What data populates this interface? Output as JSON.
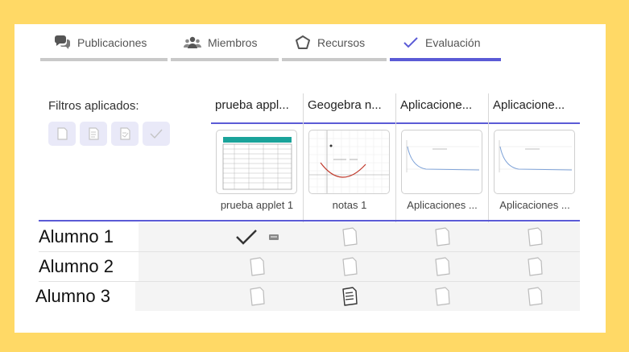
{
  "tabs": [
    {
      "label": "Publicaciones",
      "icon": "chat-bubbles-icon",
      "active": false
    },
    {
      "label": "Miembros",
      "icon": "people-icon",
      "active": false
    },
    {
      "label": "Recursos",
      "icon": "shapes-icon",
      "active": false
    },
    {
      "label": "Evaluación",
      "icon": "checkmark-icon",
      "active": true
    }
  ],
  "filters": {
    "label": "Filtros aplicados:",
    "items": [
      "page-blank-icon",
      "page-lines-icon",
      "page-edit-icon",
      "checkmark-icon"
    ]
  },
  "columns": [
    {
      "header": "prueba appl...",
      "caption": "prueba applet 1"
    },
    {
      "header": "Geogebra n...",
      "caption": "notas 1"
    },
    {
      "header": "Aplicacione...",
      "caption": "Aplicaciones ..."
    },
    {
      "header": "Aplicacione...",
      "caption": "Aplicaciones ..."
    }
  ],
  "students": [
    {
      "name": "Alumno 1",
      "cells": [
        "graded",
        "empty",
        "empty",
        "empty"
      ]
    },
    {
      "name": "Alumno 2",
      "cells": [
        "empty",
        "empty",
        "empty",
        "empty"
      ]
    },
    {
      "name": "Alumno 3",
      "cells": [
        "empty",
        "submitted",
        "empty",
        "empty"
      ]
    }
  ],
  "colors": {
    "accent": "#5b5bd6",
    "background": "#ffd966"
  }
}
